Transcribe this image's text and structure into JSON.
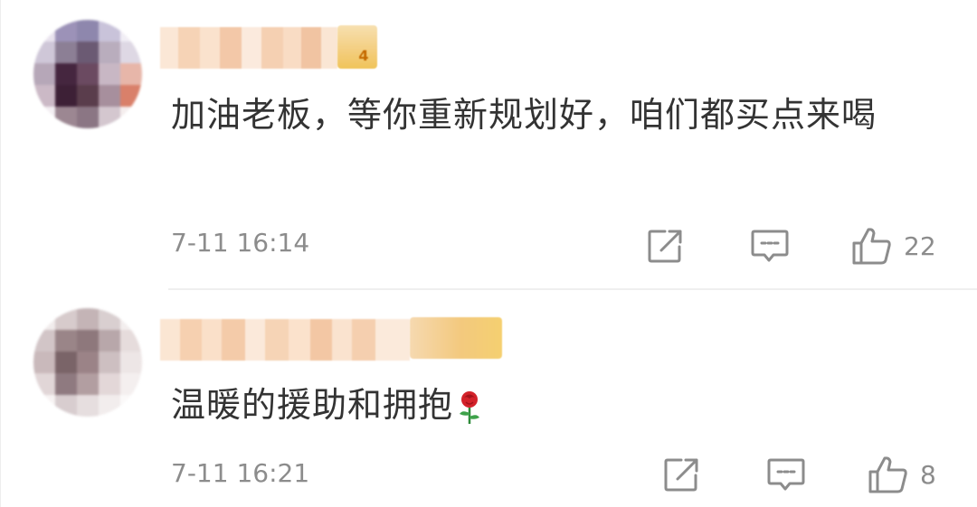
{
  "comments": [
    {
      "text": "加油老板，等你重新规划好，咱们都买点来喝",
      "time": "7-11 16:14",
      "like_count": "22",
      "badge_text": "4",
      "icons": [
        "avatar-pixelated",
        "share-icon",
        "comment-icon",
        "like-icon"
      ]
    },
    {
      "text": "温暖的援助和拥抱",
      "emoji": "rose",
      "time": "7-11 16:21",
      "like_count": "8",
      "badge_text": "",
      "icons": [
        "avatar-pixelated",
        "share-icon",
        "comment-icon",
        "like-icon"
      ]
    }
  ],
  "colors": {
    "text": "#333333",
    "meta": "#8c8c8c",
    "divider": "#efefef",
    "background": "#ffffff"
  }
}
